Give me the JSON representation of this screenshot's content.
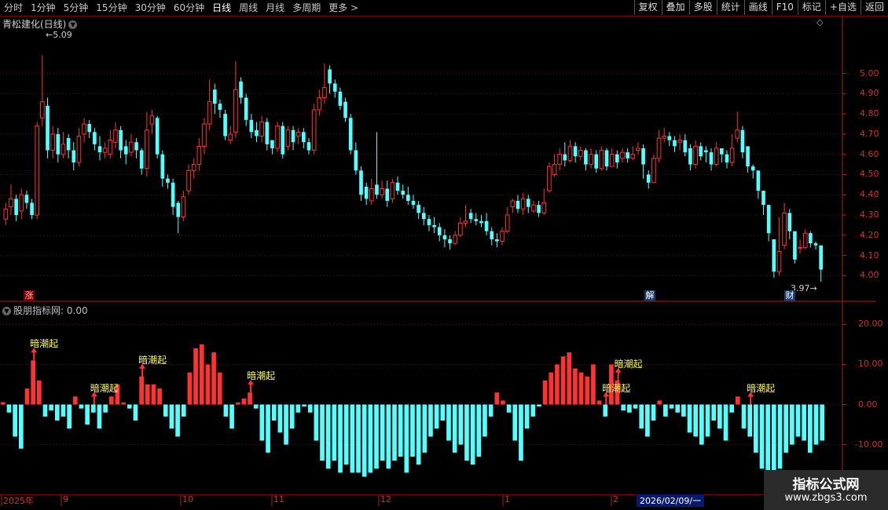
{
  "toolbar": {
    "periods": [
      "分时",
      "1分钟",
      "5分钟",
      "15分钟",
      "30分钟",
      "60分钟",
      "日线",
      "周线",
      "月线",
      "多周期",
      "更多 >"
    ],
    "active": "日线",
    "buttons": [
      "复权",
      "叠加",
      "多股",
      "统计",
      "画线",
      "F10",
      "标记",
      "+自选",
      "返回"
    ]
  },
  "chart_title": "青松建化(日线)",
  "chart_title_icon": "chevron-down-icon",
  "indicator_title": "股朋指标网",
  "indicator_value": ": 0.00",
  "high_label": "5.09",
  "low_label": "3.97",
  "event_markers": [
    "涨",
    "解",
    "财"
  ],
  "signal_label": "暗潮起",
  "watermark": {
    "line1": "指标公式网",
    "line2": "www.zbgs3.com"
  },
  "selected_date": "2026/02/09/一",
  "colors": {
    "up": "#ff3232",
    "down": "#54ffff",
    "signal": "#ffff40",
    "axis": "#b41e1e",
    "background": "#000000"
  },
  "chart_data": [
    {
      "type": "candlestick",
      "title": "青松建化(日线)",
      "ylim": [
        3.92,
        5.2
      ],
      "yticks": [
        4.0,
        4.1,
        4.2,
        4.3,
        4.4,
        4.5,
        4.6,
        4.7,
        4.8,
        4.9,
        5.0
      ],
      "x_labels": [
        "2025年",
        "9",
        "10",
        "11",
        "12",
        "1",
        "2",
        "2026/02/09/一"
      ],
      "closes": [
        4.33,
        4.38,
        4.3,
        4.4,
        4.36,
        4.3,
        4.74,
        4.86,
        4.62,
        4.7,
        4.6,
        4.65,
        4.62,
        4.56,
        4.69,
        4.75,
        4.71,
        4.65,
        4.61,
        4.63,
        4.67,
        4.72,
        4.62,
        4.6,
        4.66,
        4.62,
        4.53,
        4.72,
        4.79,
        4.6,
        4.48,
        4.46,
        4.34,
        4.29,
        4.39,
        4.52,
        4.55,
        4.64,
        4.75,
        4.86,
        4.85,
        4.82,
        4.69,
        4.7,
        4.92,
        4.88,
        4.77,
        4.71,
        4.69,
        4.76,
        4.65,
        4.63,
        4.74,
        4.6,
        4.72,
        4.66,
        4.71,
        4.66,
        4.62,
        4.82,
        4.88,
        4.93,
        4.95,
        4.91,
        4.84,
        4.78,
        4.62,
        4.52,
        4.4,
        4.38,
        4.43,
        4.4,
        4.43,
        4.37,
        4.46,
        4.42,
        4.4,
        4.37,
        4.35,
        4.31,
        4.28,
        4.25,
        4.24,
        4.2,
        4.18,
        4.16,
        4.2,
        4.26,
        4.27,
        4.28,
        4.27,
        4.26,
        4.22,
        4.18,
        4.17,
        4.22,
        4.3,
        4.37,
        4.33,
        4.38,
        4.34,
        4.35,
        4.31,
        4.36,
        4.54,
        4.55,
        4.6,
        4.57,
        4.64,
        4.59,
        4.62,
        4.55,
        4.6,
        4.53,
        4.62,
        4.54,
        4.6,
        4.56,
        4.61,
        4.58,
        4.6,
        4.63,
        4.55,
        4.46,
        4.58,
        4.68,
        4.69,
        4.67,
        4.64,
        4.67,
        4.61,
        4.55,
        4.64,
        4.59,
        4.61,
        4.55,
        4.63,
        4.6,
        4.56,
        4.63,
        4.72,
        4.61,
        4.54,
        4.52,
        4.42,
        4.35,
        4.21,
        4.02,
        4.12,
        4.31,
        4.22,
        4.08,
        4.14,
        4.21,
        4.16,
        4.15,
        4.03
      ],
      "opens": [
        4.28,
        4.34,
        4.38,
        4.32,
        4.4,
        4.36,
        4.3,
        4.78,
        4.84,
        4.62,
        4.7,
        4.6,
        4.68,
        4.62,
        4.56,
        4.7,
        4.75,
        4.71,
        4.64,
        4.61,
        4.6,
        4.66,
        4.72,
        4.64,
        4.61,
        4.66,
        4.62,
        4.53,
        4.75,
        4.78,
        4.6,
        4.48,
        4.46,
        4.36,
        4.29,
        4.42,
        4.52,
        4.55,
        4.64,
        4.75,
        4.92,
        4.85,
        4.8,
        4.67,
        4.71,
        4.96,
        4.88,
        4.77,
        4.72,
        4.69,
        4.76,
        4.67,
        4.63,
        4.74,
        4.64,
        4.72,
        4.69,
        4.71,
        4.66,
        4.62,
        4.82,
        4.88,
        5.02,
        4.95,
        4.91,
        4.86,
        4.78,
        4.62,
        4.52,
        4.44,
        4.37,
        4.45,
        4.4,
        4.43,
        4.38,
        4.46,
        4.42,
        4.4,
        4.37,
        4.35,
        4.31,
        4.28,
        4.25,
        4.24,
        4.2,
        4.18,
        4.16,
        4.2,
        4.26,
        4.31,
        4.28,
        4.27,
        4.27,
        4.22,
        4.18,
        4.17,
        4.22,
        4.34,
        4.37,
        4.33,
        4.38,
        4.32,
        4.35,
        4.31,
        4.42,
        4.5,
        4.55,
        4.6,
        4.57,
        4.64,
        4.59,
        4.62,
        4.55,
        4.6,
        4.53,
        4.62,
        4.54,
        4.6,
        4.58,
        4.61,
        4.58,
        4.62,
        4.63,
        4.5,
        4.46,
        4.58,
        4.68,
        4.69,
        4.67,
        4.66,
        4.67,
        4.63,
        4.55,
        4.64,
        4.62,
        4.61,
        4.55,
        4.63,
        4.6,
        4.56,
        4.68,
        4.72,
        4.64,
        4.54,
        4.52,
        4.42,
        4.35,
        4.18,
        4.02,
        4.15,
        4.31,
        4.22,
        4.14,
        4.14,
        4.21,
        4.16,
        4.15
      ],
      "highs": [
        4.36,
        4.45,
        4.4,
        4.43,
        4.42,
        4.38,
        4.76,
        5.09,
        4.88,
        4.74,
        4.73,
        4.71,
        4.7,
        4.66,
        4.73,
        4.78,
        4.77,
        4.73,
        4.69,
        4.66,
        4.72,
        4.76,
        4.74,
        4.67,
        4.7,
        4.68,
        4.63,
        4.81,
        4.82,
        4.79,
        4.62,
        4.5,
        4.48,
        4.37,
        4.42,
        4.55,
        4.58,
        4.68,
        4.78,
        4.97,
        4.95,
        4.87,
        4.82,
        4.74,
        5.06,
        4.98,
        4.9,
        4.8,
        4.76,
        4.79,
        4.78,
        4.67,
        4.76,
        4.76,
        4.74,
        4.74,
        4.73,
        4.73,
        4.68,
        4.85,
        4.92,
        5.05,
        5.04,
        4.97,
        4.93,
        4.88,
        4.8,
        4.66,
        4.54,
        4.46,
        4.48,
        4.71,
        4.47,
        4.47,
        4.48,
        4.49,
        4.45,
        4.44,
        4.4,
        4.37,
        4.34,
        4.3,
        4.29,
        4.26,
        4.23,
        4.2,
        4.22,
        4.29,
        4.35,
        4.33,
        4.31,
        4.3,
        4.31,
        4.24,
        4.21,
        4.24,
        4.34,
        4.38,
        4.4,
        4.41,
        4.4,
        4.37,
        4.37,
        4.43,
        4.56,
        4.6,
        4.63,
        4.66,
        4.67,
        4.66,
        4.64,
        4.63,
        4.63,
        4.62,
        4.64,
        4.63,
        4.63,
        4.62,
        4.63,
        4.63,
        4.64,
        4.66,
        4.65,
        4.52,
        4.6,
        4.72,
        4.73,
        4.71,
        4.69,
        4.7,
        4.7,
        4.65,
        4.67,
        4.66,
        4.64,
        4.63,
        4.66,
        4.63,
        4.62,
        4.7,
        4.81,
        4.74,
        4.58,
        4.55,
        4.46,
        4.4,
        4.24,
        4.12,
        4.29,
        4.36,
        4.33,
        4.22,
        4.18,
        4.23,
        4.22,
        4.17,
        4.07
      ],
      "lows": [
        4.25,
        4.3,
        4.27,
        4.28,
        4.33,
        4.28,
        4.28,
        4.74,
        4.58,
        4.58,
        4.56,
        4.58,
        4.58,
        4.52,
        4.54,
        4.66,
        4.68,
        4.62,
        4.57,
        4.58,
        4.58,
        4.63,
        4.58,
        4.55,
        4.59,
        4.58,
        4.5,
        4.49,
        4.7,
        4.58,
        4.44,
        4.43,
        4.3,
        4.21,
        4.27,
        4.4,
        4.48,
        4.52,
        4.6,
        4.72,
        4.8,
        4.78,
        4.67,
        4.65,
        4.68,
        4.85,
        4.74,
        4.68,
        4.66,
        4.66,
        4.62,
        4.6,
        4.61,
        4.58,
        4.62,
        4.62,
        4.65,
        4.63,
        4.6,
        4.6,
        4.79,
        4.85,
        4.9,
        4.88,
        4.82,
        4.76,
        4.6,
        4.5,
        4.37,
        4.35,
        4.35,
        4.38,
        4.38,
        4.34,
        4.36,
        4.4,
        4.38,
        4.35,
        4.33,
        4.28,
        4.25,
        4.22,
        4.21,
        4.17,
        4.14,
        4.13,
        4.15,
        4.19,
        4.24,
        4.26,
        4.25,
        4.24,
        4.2,
        4.15,
        4.14,
        4.15,
        4.21,
        4.31,
        4.31,
        4.3,
        4.31,
        4.31,
        4.29,
        4.3,
        4.41,
        4.49,
        4.52,
        4.54,
        4.56,
        4.56,
        4.57,
        4.52,
        4.53,
        4.51,
        4.52,
        4.52,
        4.54,
        4.53,
        4.56,
        4.56,
        4.57,
        4.6,
        4.48,
        4.43,
        4.46,
        4.56,
        4.66,
        4.64,
        4.61,
        4.62,
        4.59,
        4.52,
        4.53,
        4.57,
        4.56,
        4.52,
        4.54,
        4.56,
        4.53,
        4.54,
        4.66,
        4.58,
        4.51,
        4.48,
        4.38,
        4.3,
        4.17,
        3.99,
        4.0,
        4.13,
        4.18,
        4.06,
        4.11,
        4.13,
        4.14,
        4.13,
        3.97
      ]
    },
    {
      "type": "bar",
      "title": "股朋指标网",
      "ylim": [
        -22,
        23
      ],
      "yticks": [
        -10.0,
        0.0,
        10.0,
        20.0
      ],
      "values": [
        0.6,
        -2,
        -8,
        -11,
        4,
        11,
        6,
        -3,
        -1.5,
        -4,
        -3,
        -6,
        2,
        -1,
        -5,
        -2,
        -6,
        -2,
        2,
        5,
        0.5,
        -1,
        -4,
        7,
        5,
        5,
        4,
        -3,
        -6,
        -8,
        -3,
        8,
        14,
        15,
        10,
        13,
        8,
        -3,
        -6,
        0.5,
        1.5,
        3,
        -1,
        -9,
        -12,
        -4,
        -7,
        -10,
        -6,
        -2,
        -0.5,
        -2,
        -9,
        -14,
        -16,
        -14,
        -17,
        -15,
        -17,
        -17,
        -18,
        -17,
        -16,
        -14,
        -16,
        -14,
        -13,
        -17,
        -13,
        -15,
        -12,
        -8,
        -6,
        -4,
        -9,
        -12,
        -10,
        -14,
        -15,
        -13,
        -8,
        -3,
        3,
        1,
        -2,
        -9,
        -14,
        -6,
        -3,
        -0.5,
        6,
        8,
        10,
        12,
        13,
        9,
        8,
        7,
        10,
        1,
        -3,
        10,
        6,
        -1.5,
        -2,
        -1,
        -6,
        -8,
        -4,
        1,
        -3,
        -1,
        -2,
        -3,
        -7,
        -8,
        -10,
        -8,
        -4,
        -6,
        -9,
        -2,
        2,
        -6,
        -8,
        -12,
        -16,
        -21,
        -20,
        -16,
        -12,
        -10,
        -8,
        -9,
        -12,
        -10,
        -9
      ],
      "signal_positions": [
        5,
        15,
        23,
        41,
        100,
        102,
        124
      ]
    }
  ]
}
